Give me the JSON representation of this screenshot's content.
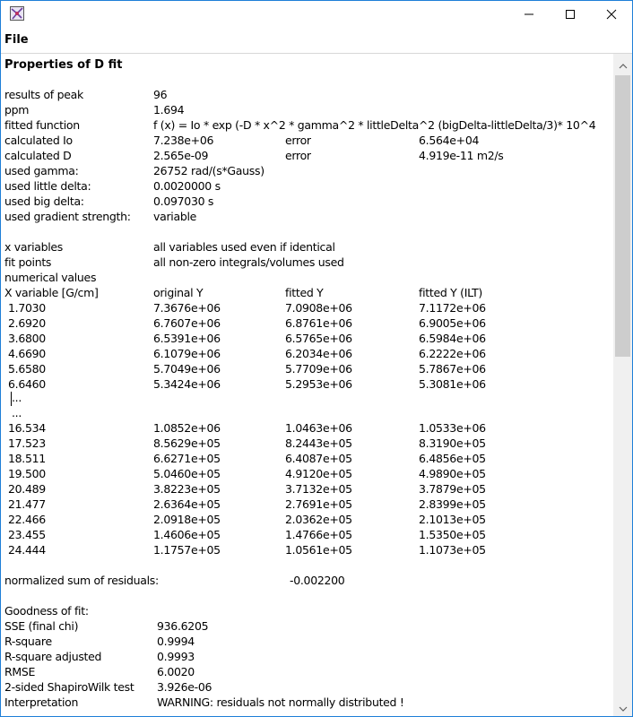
{
  "window": {
    "menu": {
      "file_label": "File"
    }
  },
  "report": {
    "heading": "Properties of D fit",
    "params": [
      {
        "label": "results of peak",
        "value": "96"
      },
      {
        "label": "ppm",
        "value": "1.694"
      },
      {
        "label": "fitted function",
        "value": "f (x) = Io * exp (-D * x^2 * gamma^2 * littleDelta^2 (bigDelta-littleDelta/3)* 10^4"
      },
      {
        "label": "calculated Io",
        "value": "7.238e+06",
        "err_label": "error",
        "err_value": "6.564e+04"
      },
      {
        "label": "calculated D",
        "value": "2.565e-09",
        "err_label": "error",
        "err_value": "4.919e-11 m2/s"
      },
      {
        "label": "used gamma:",
        "value": "26752 rad/(s*Gauss)"
      },
      {
        "label": "used little delta:",
        "value": "0.0020000 s"
      },
      {
        "label": "used big delta:",
        "value": "0.097030 s"
      },
      {
        "label": "used gradient strength:",
        "value": "variable"
      }
    ],
    "settings": [
      {
        "label": "x variables",
        "value": "all variables used even if identical"
      },
      {
        "label": "fit points",
        "value": "all non-zero integrals/volumes used"
      }
    ],
    "numerical_values_label": "numerical values",
    "table": {
      "headers": [
        "X variable [G/cm]",
        "original Y",
        "fitted Y",
        "fitted Y (ILT)"
      ],
      "rows_top": [
        [
          "1.7030",
          "7.3676e+06",
          "7.0908e+06",
          "7.1172e+06"
        ],
        [
          "2.6920",
          "6.7607e+06",
          "6.8761e+06",
          "6.9005e+06"
        ],
        [
          "3.6800",
          "6.5391e+06",
          "6.5765e+06",
          "6.5984e+06"
        ],
        [
          "4.6690",
          "6.1079e+06",
          "6.2034e+06",
          "6.2222e+06"
        ],
        [
          "5.6580",
          "5.7049e+06",
          "5.7709e+06",
          "5.7867e+06"
        ],
        [
          "6.6460",
          "5.3424e+06",
          "5.2953e+06",
          "5.3081e+06"
        ]
      ],
      "ellipsis_1": "...",
      "ellipsis_2": "...",
      "rows_bottom": [
        [
          "16.534",
          "1.0852e+06",
          "1.0463e+06",
          "1.0533e+06"
        ],
        [
          "17.523",
          "8.5629e+05",
          "8.2443e+05",
          "8.3190e+05"
        ],
        [
          "18.511",
          "6.6271e+05",
          "6.4087e+05",
          "6.4856e+05"
        ],
        [
          "19.500",
          "5.0460e+05",
          "4.9120e+05",
          "4.9890e+05"
        ],
        [
          "20.489",
          "3.8223e+05",
          "3.7132e+05",
          "3.7879e+05"
        ],
        [
          "21.477",
          "2.6364e+05",
          "2.7691e+05",
          "2.8399e+05"
        ],
        [
          "22.466",
          "2.0918e+05",
          "2.0362e+05",
          "2.1013e+05"
        ],
        [
          "23.455",
          "1.4606e+05",
          "1.4766e+05",
          "1.5350e+05"
        ],
        [
          "24.444",
          "1.1757e+05",
          "1.0561e+05",
          "1.1073e+05"
        ]
      ]
    },
    "residuals": {
      "label": "normalized sum of residuals:",
      "value": "-0.002200"
    },
    "goodness": {
      "title": "Goodness of fit:",
      "items": [
        {
          "label": "SSE (final chi)",
          "value": "936.6205"
        },
        {
          "label": "R-square",
          "value": "0.9994"
        },
        {
          "label": "R-square adjusted",
          "value": "0.9993"
        },
        {
          "label": "RMSE",
          "value": "6.0020"
        },
        {
          "label": "2-sided ShapiroWilk test",
          "value": "3.926e-06"
        },
        {
          "label": "Interpretation",
          "value": "WARNING: residuals not normally distributed !"
        }
      ]
    }
  },
  "icons": {
    "app": "app-icon",
    "minimize": "minimize-icon",
    "maximize": "maximize-icon",
    "close": "close-icon",
    "scroll_up": "scroll-up-icon",
    "scroll_down": "scroll-down-icon"
  },
  "colors": {
    "window_border": "#1e7fd8",
    "scroll_track": "#f0f0f0",
    "scroll_thumb": "#cdcdcd"
  }
}
